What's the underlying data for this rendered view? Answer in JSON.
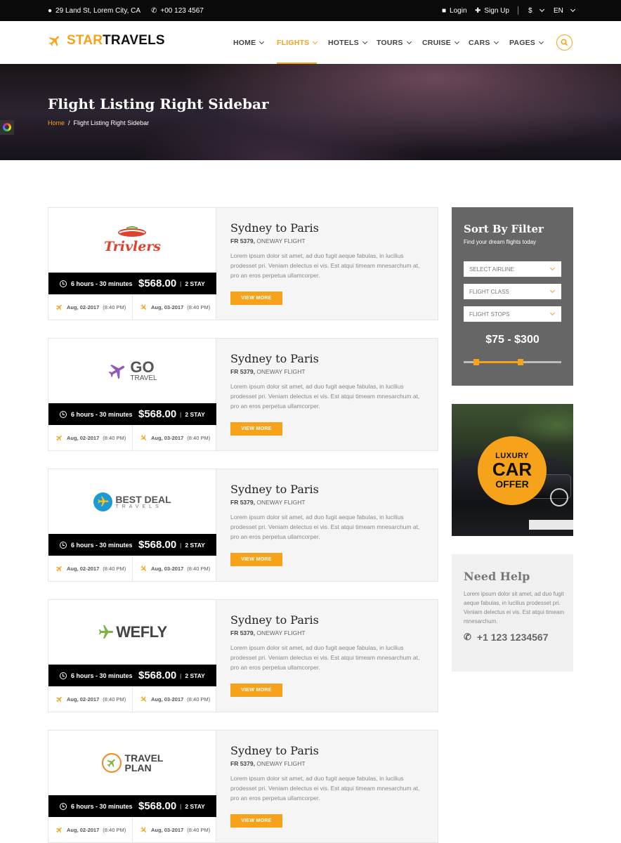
{
  "topbar": {
    "address": "29 Land St, Lorem City, CA",
    "phone": "+00 123 4567",
    "login": "Login",
    "signup": "Sign Up",
    "currency": "$",
    "language": "EN"
  },
  "brand": {
    "star": "STAR",
    "rest": "TRAVELS"
  },
  "nav": [
    {
      "label": "HOME"
    },
    {
      "label": "FLIGHTS"
    },
    {
      "label": "HOTELS"
    },
    {
      "label": "TOURS"
    },
    {
      "label": "CRUISE"
    },
    {
      "label": "CARS"
    },
    {
      "label": "PAGES"
    }
  ],
  "hero": {
    "title": "Flight Listing Right Sidebar",
    "breadcrumb_home": "Home",
    "breadcrumb_sep": "/",
    "breadcrumb_current": "Flight Listing Right Sidebar"
  },
  "flights": [
    {
      "airline_logo": "Trivlers",
      "duration": "6 hours - 30 minutes",
      "price": "$568.00",
      "stay": "2 STAY",
      "depart_date": "Aug, 02-2017",
      "depart_time": "(8:40 PM)",
      "arrive_date": "Aug, 03-2017",
      "arrive_time": "(8:40 PM)",
      "title": "Sydney to Paris",
      "code": "FR 5379,",
      "type": "ONEWAY FLIGHT",
      "desc": "Lorem ipsum dolor sit amet, ad duo fugit aeque fabulas, in lucilius prodesset pri. Veniam delectus ei vis. Est atqui timeam mnesarchum at, pro an eros perpetua ullamcorper.",
      "button": "VIEW MORE"
    },
    {
      "airline_logo": "GO",
      "airline_logo_sub": "TRAVEL",
      "duration": "6 hours - 30 minutes",
      "price": "$568.00",
      "stay": "2 STAY",
      "depart_date": "Aug, 02-2017",
      "depart_time": "(8:40 PM)",
      "arrive_date": "Aug, 03-2017",
      "arrive_time": "(8:40 PM)",
      "title": "Sydney to Paris",
      "code": "FR 5379,",
      "type": "ONEWAY FLIGHT",
      "desc": "Lorem ipsum dolor sit amet, ad duo fugit aeque fabulas, in lucilius prodesset pri. Veniam delectus ei vis. Est atqui timeam mnesarchum at, pro an eros perpetua ullamcorper.",
      "button": "VIEW MORE"
    },
    {
      "airline_logo": "BEST DEAL",
      "airline_logo_sub": "TRAVELS",
      "duration": "6 hours - 30 minutes",
      "price": "$568.00",
      "stay": "2 STAY",
      "depart_date": "Aug, 02-2017",
      "depart_time": "(8:40 PM)",
      "arrive_date": "Aug, 03-2017",
      "arrive_time": "(8:40 PM)",
      "title": "Sydney to Paris",
      "code": "FR 5379,",
      "type": "ONEWAY FLIGHT",
      "desc": "Lorem ipsum dolor sit amet, ad duo fugit aeque fabulas, in lucilius prodesset pri. Veniam delectus ei vis. Est atqui timeam mnesarchum at, pro an eros perpetua ullamcorper.",
      "button": "VIEW MORE"
    },
    {
      "airline_logo": "WEFLY",
      "duration": "6 hours - 30 minutes",
      "price": "$568.00",
      "stay": "2 STAY",
      "depart_date": "Aug, 02-2017",
      "depart_time": "(8:40 PM)",
      "arrive_date": "Aug, 03-2017",
      "arrive_time": "(8:40 PM)",
      "title": "Sydney to Paris",
      "code": "FR 5379,",
      "type": "ONEWAY FLIGHT",
      "desc": "Lorem ipsum dolor sit amet, ad duo fugit aeque fabulas, in lucilius prodesset pri. Veniam delectus ei vis. Est atqui timeam mnesarchum at, pro an eros perpetua ullamcorper.",
      "button": "VIEW MORE"
    },
    {
      "airline_logo": "TRAVEL",
      "airline_logo_sub": "PLAN",
      "duration": "6 hours - 30 minutes",
      "price": "$568.00",
      "stay": "2 STAY",
      "depart_date": "Aug, 02-2017",
      "depart_time": "(8:40 PM)",
      "arrive_date": "Aug, 03-2017",
      "arrive_time": "(8:40 PM)",
      "title": "Sydney to Paris",
      "code": "FR 5379,",
      "type": "ONEWAY FLIGHT",
      "desc": "Lorem ipsum dolor sit amet, ad duo fugit aeque fabulas, in lucilius prodesset pri. Veniam delectus ei vis. Est atqui timeam mnesarchum at, pro an eros perpetua ullamcorper.",
      "button": "VIEW MORE"
    }
  ],
  "filter": {
    "title": "Sort By Filter",
    "subtitle": "Find your dream flights today",
    "selects": [
      "SELECT AIRLINE",
      "FLIGHT CLASS",
      "FLIGHT STOPS"
    ],
    "price_range": "$75 - $300",
    "slider_low_fraction": 0.13,
    "slider_high_fraction": 0.58
  },
  "car_ad": {
    "line1": "LUXURY",
    "line2": "CAR",
    "line3": "OFFER"
  },
  "help": {
    "title": "Need Help",
    "desc": "Lorem ipsum dolor sit amet, ad duo fugit aeque fabulas, in lucilius prodesset pri. Veniam delectus ei vis. Est atqui timeam mnesarchum.",
    "phone": "+1 123 1234567"
  },
  "colors": {
    "accent": "#f7a21b",
    "topbar": "#0a0a0a",
    "filter_bg": "#666666"
  }
}
